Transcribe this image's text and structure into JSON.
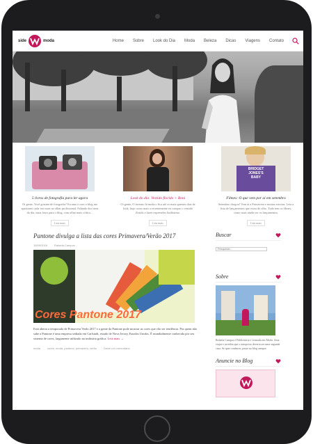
{
  "site": {
    "logo_left": "side",
    "logo_right": "moda",
    "nav": [
      "Home",
      "Sobre",
      "Look do Dia",
      "Moda",
      "Beleza",
      "Dicas",
      "Viagens",
      "Contato"
    ]
  },
  "featured": [
    {
      "title": "5 livros de fotografia para ler agora",
      "text": "Oi gente, Você gostam de fotografia? Eu amo e com o blog me apaixonei cada vez mais no olhar profissional. Falando dos itens do dia, mais fotos para o blog, com olhar mais crítico...",
      "more": "Leia mais"
    },
    {
      "title": "Look do dia: Vestido florido + Bota",
      "text": "Oi gente, O inverno lá moda o fica até os mais quentes dias de look, hoje como mais a recentemente eu compro o vestido florido e fazer expressões lindíssimo.",
      "more": "Leia mais"
    },
    {
      "title": "Filmes: O que vem por aí em setembro",
      "text": "Setembro chegou! Vem ai a Primavera e muitas estreias. Leia a lista de lançamentos que estou de olho. Tudo tem os filmes, como mais ainda ver os lançamentos.",
      "more": "Leia mais",
      "image_text": [
        "BRIDGET",
        "JONES'S",
        "BABY"
      ]
    }
  ],
  "post": {
    "title": "Pantone divulga a lista das cores Primavera/Verão 2017",
    "date": "15/09/2016",
    "author": "Rafaela Campos",
    "image_caption": "Cores Pantone 2017",
    "body": "Está aberta a temporada de Primavera Verão 2017 e a gente da Pantone pode mostrar as cores que vão ser tendência. Pra quem não sabe a Pantone é uma empresa sediada em Carlstadt, estado de Nova Jersey, Estados Unidos. É mundialmente conhecida por seu sistema de cores, largamente utilizado na indústria gráfica.",
    "read_more": "Leia mais →",
    "category": "moda",
    "tags": "cores, moda, pantone, primavera, verão",
    "comments": "Deixe um comentário"
  },
  "sidebar": {
    "search_title": "Buscar",
    "search_placeholder": "Pesquisar...",
    "about_title": "Sobre",
    "about_text": "Rafaela Campos é Publicitária e formada em Moda. Ama viajar e acredita que o autoposto deveria ser uma segunda casa. Se quer conhecer, passe no blog sempre.",
    "ad_title": "Anuncie no Blog"
  },
  "colors": {
    "accent": "#c2185b",
    "logo": "#c2185b",
    "caption": "#ff6a3d"
  }
}
